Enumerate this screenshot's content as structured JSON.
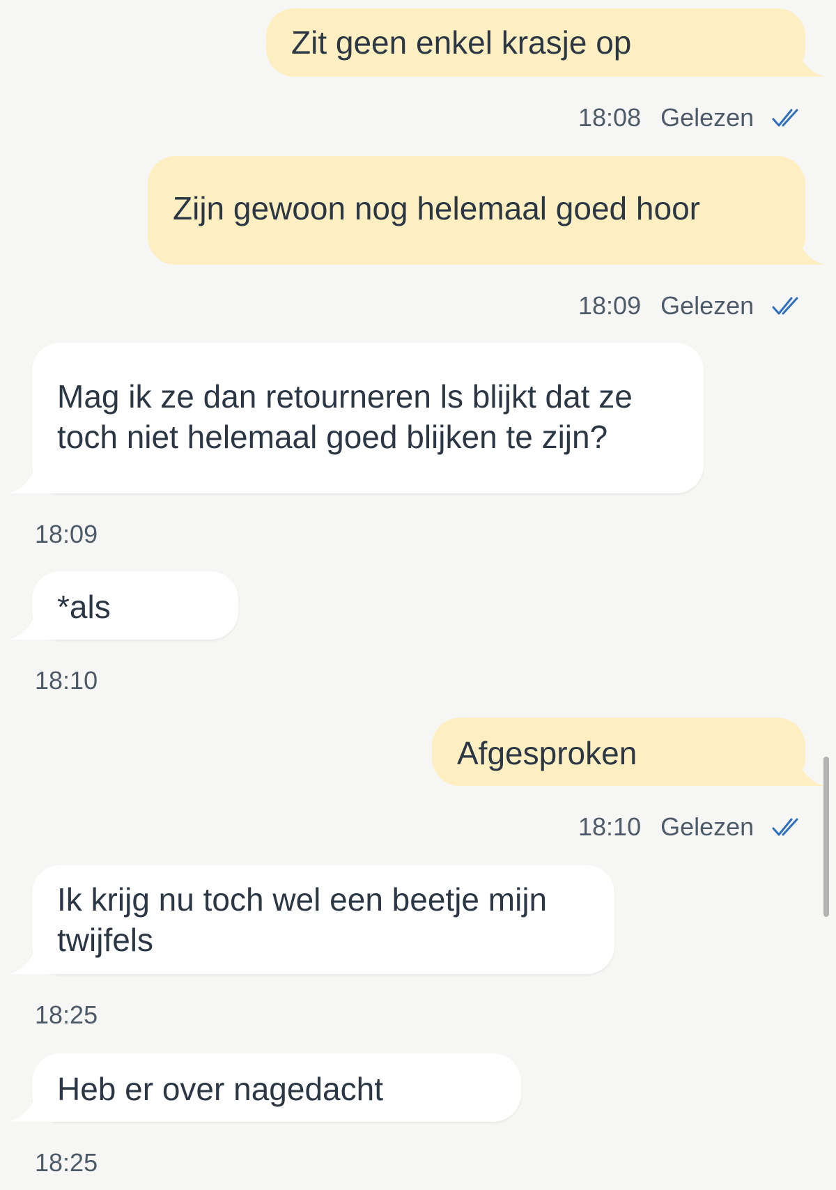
{
  "messages": [
    {
      "direction": "out",
      "text": "Zit geen enkel krasje op",
      "time": "18:08",
      "status": "Gelezen"
    },
    {
      "direction": "out",
      "text": "Zijn gewoon nog helemaal goed hoor",
      "time": "18:09",
      "status": "Gelezen"
    },
    {
      "direction": "in",
      "text": "Mag ik ze dan retourneren ls blijkt dat ze toch niet helemaal goed blijken te zijn?",
      "time": "18:09"
    },
    {
      "direction": "in",
      "text": "*als",
      "time": "18:10"
    },
    {
      "direction": "out",
      "text": "Afgesproken",
      "time": "18:10",
      "status": "Gelezen"
    },
    {
      "direction": "in",
      "text": "Ik krijg nu toch wel een beetje mijn twijfels",
      "time": "18:25"
    },
    {
      "direction": "in",
      "text": "Heb er over nagedacht",
      "time": "18:25"
    }
  ],
  "colors": {
    "background": "#f6f6f4",
    "outgoing_bubble": "#fdefc1",
    "incoming_bubble": "#ffffff",
    "read_check": "#2f6fc0"
  },
  "icons": {
    "read_receipt": "double-check-icon"
  }
}
